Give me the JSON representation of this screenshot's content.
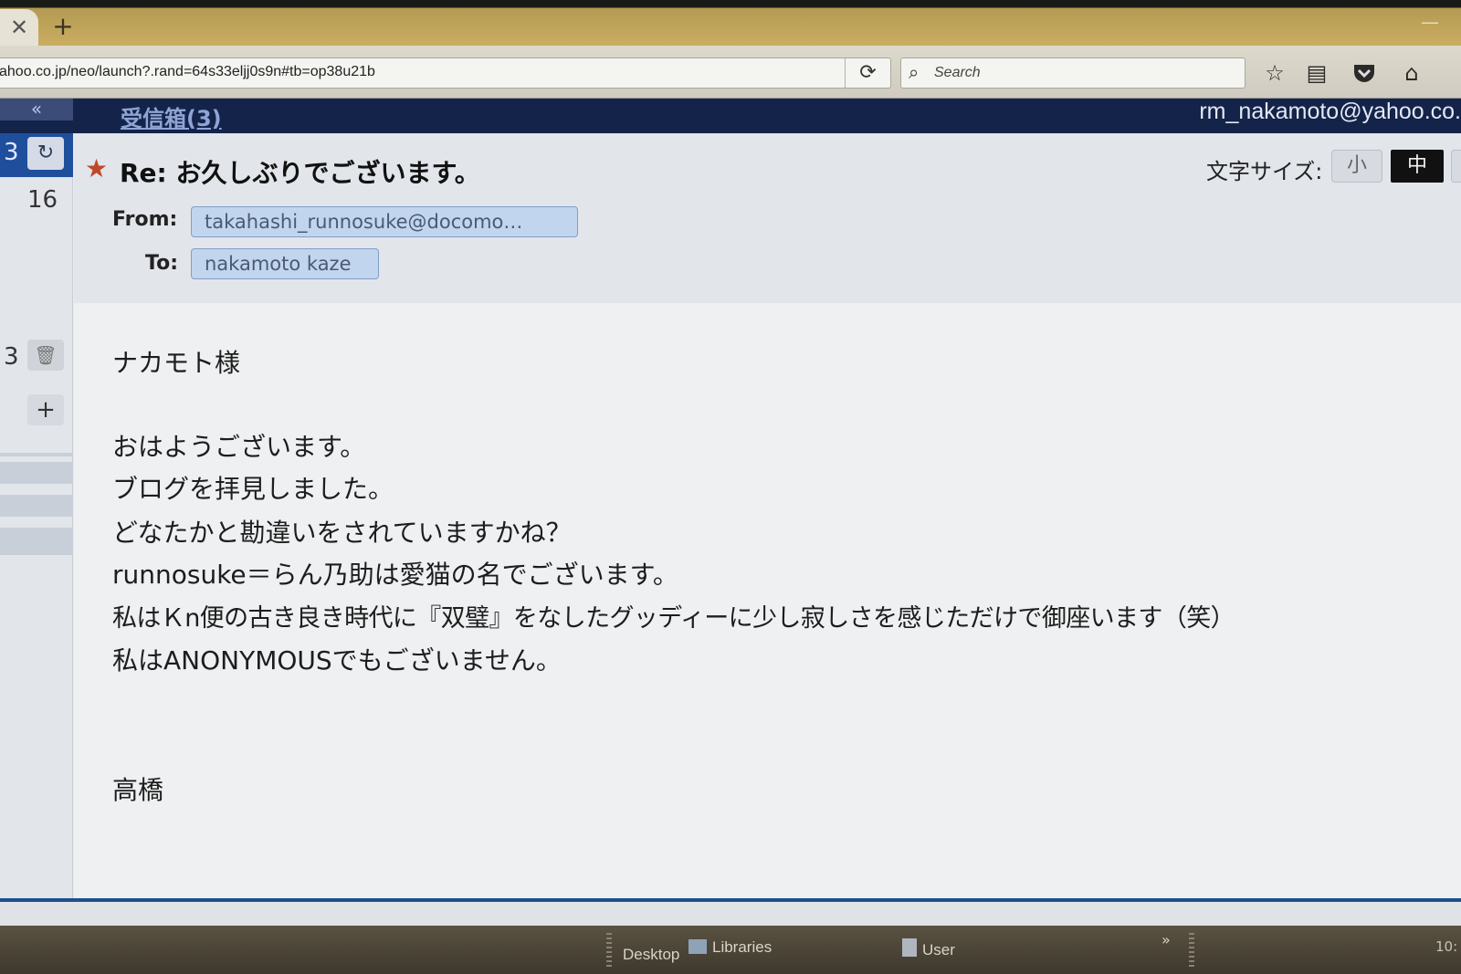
{
  "browser": {
    "url": "ahoo.co.jp/neo/launch?.rand=64s33eljj0s9n#tb=op38u21b",
    "search_placeholder": "Search",
    "tab_close": "✕",
    "tab_new": "+",
    "icons": [
      "reload-icon",
      "search-icon",
      "bookmark-star-icon",
      "reading-list-icon",
      "pocket-icon",
      "home-icon"
    ]
  },
  "mail": {
    "collapse_label": "«",
    "folder_title": "受信箱(3)",
    "account": "rm_nakamoto@yahoo.co.",
    "left": {
      "inbox_count": "3",
      "count_16": "16",
      "trash_count": "3",
      "add_label": "+"
    },
    "message": {
      "subject": "Re: お久しぶりでございます。",
      "font_size_label": "文字サイズ:",
      "font_size_small": "小",
      "font_size_medium": "中",
      "from_label": "From:",
      "from_value": "takahashi_runnosuke@docomo…",
      "to_label": "To:",
      "to_value": "nakamoto kaze",
      "body_lines": [
        "ナカモト様",
        "おはようございます。",
        "ブログを拝見しました。",
        "どなたかと勘違いをされていますかね？",
        "runnosuke＝らん乃助は愛猫の名でございます。",
        "私はＫn便の古き良き時代に『双璧』をなしたグッディーに少し寂しさを感じただけで御座います（笑）",
        "私はANONYMOUSでもございません。",
        "高橋"
      ]
    }
  },
  "taskbar": {
    "desktop": "Desktop",
    "libraries": "Libraries",
    "user": "User",
    "overflow": "»",
    "clock": "10:"
  }
}
